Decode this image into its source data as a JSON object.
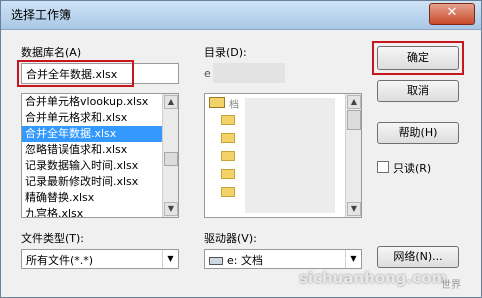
{
  "window": {
    "title": "选择工作簿",
    "close_glyph": "✕"
  },
  "db": {
    "label": "数据库名(A)",
    "value": "合并全年数据.xlsx",
    "items": [
      "合并单元格vlookup.xlsx",
      "合并单元格求和.xlsx",
      "合并全年数据.xlsx",
      "忽略错误值求和.xlsx",
      "记录数据输入时间.xlsx",
      "记录最新修改时间.xlsx",
      "精确替换.xlsx",
      "九宫格.xlsx"
    ],
    "selected_index": 2
  },
  "directory": {
    "label": "目录(D):",
    "path_prefix": "e",
    "root_label": "档"
  },
  "filetype": {
    "label": "文件类型(T):",
    "value": "所有文件(*.*)"
  },
  "drive": {
    "label": "驱动器(V):",
    "value": "e: 文档"
  },
  "buttons": {
    "ok": "确定",
    "cancel": "取消",
    "help": "帮助(H)",
    "readonly": "只读(R)",
    "network": "网络(N)..."
  },
  "watermark": {
    "text": "sichuanhong.com",
    "tail": "世界"
  },
  "colors": {
    "highlight": "#c8161e",
    "selection": "#3399ff"
  }
}
